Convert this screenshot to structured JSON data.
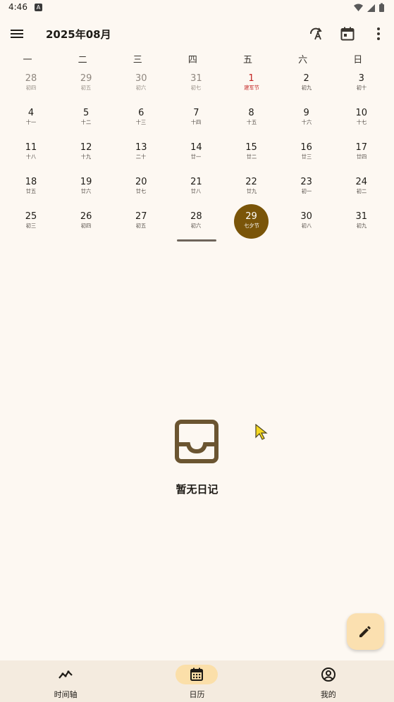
{
  "status_bar": {
    "time": "4:46",
    "notification_glyph": "A"
  },
  "app_bar": {
    "title": "2025年08月"
  },
  "weekdays": [
    "一",
    "二",
    "三",
    "四",
    "五",
    "六",
    "日"
  ],
  "calendar": {
    "weeks": [
      [
        {
          "day": "28",
          "lunar": "初四",
          "state": "other"
        },
        {
          "day": "29",
          "lunar": "初五",
          "state": "other"
        },
        {
          "day": "30",
          "lunar": "初六",
          "state": "other"
        },
        {
          "day": "31",
          "lunar": "初七",
          "state": "other"
        },
        {
          "day": "1",
          "lunar": "建军节",
          "state": "holiday"
        },
        {
          "day": "2",
          "lunar": "初九",
          "state": "normal"
        },
        {
          "day": "3",
          "lunar": "初十",
          "state": "normal"
        }
      ],
      [
        {
          "day": "4",
          "lunar": "十一",
          "state": "normal"
        },
        {
          "day": "5",
          "lunar": "十二",
          "state": "normal"
        },
        {
          "day": "6",
          "lunar": "十三",
          "state": "normal"
        },
        {
          "day": "7",
          "lunar": "十四",
          "state": "normal"
        },
        {
          "day": "8",
          "lunar": "十五",
          "state": "normal"
        },
        {
          "day": "9",
          "lunar": "十六",
          "state": "normal"
        },
        {
          "day": "10",
          "lunar": "十七",
          "state": "normal"
        }
      ],
      [
        {
          "day": "11",
          "lunar": "十八",
          "state": "normal"
        },
        {
          "day": "12",
          "lunar": "十九",
          "state": "normal"
        },
        {
          "day": "13",
          "lunar": "二十",
          "state": "normal"
        },
        {
          "day": "14",
          "lunar": "廿一",
          "state": "normal"
        },
        {
          "day": "15",
          "lunar": "廿二",
          "state": "normal"
        },
        {
          "day": "16",
          "lunar": "廿三",
          "state": "normal"
        },
        {
          "day": "17",
          "lunar": "廿四",
          "state": "normal"
        }
      ],
      [
        {
          "day": "18",
          "lunar": "廿五",
          "state": "normal"
        },
        {
          "day": "19",
          "lunar": "廿六",
          "state": "normal"
        },
        {
          "day": "20",
          "lunar": "廿七",
          "state": "normal"
        },
        {
          "day": "21",
          "lunar": "廿八",
          "state": "normal"
        },
        {
          "day": "22",
          "lunar": "廿九",
          "state": "normal"
        },
        {
          "day": "23",
          "lunar": "初一",
          "state": "normal"
        },
        {
          "day": "24",
          "lunar": "初二",
          "state": "normal"
        }
      ],
      [
        {
          "day": "25",
          "lunar": "初三",
          "state": "normal"
        },
        {
          "day": "26",
          "lunar": "初四",
          "state": "normal"
        },
        {
          "day": "27",
          "lunar": "初五",
          "state": "normal"
        },
        {
          "day": "28",
          "lunar": "初六",
          "state": "normal"
        },
        {
          "day": "29",
          "lunar": "七夕节",
          "state": "selected"
        },
        {
          "day": "30",
          "lunar": "初八",
          "state": "normal"
        },
        {
          "day": "31",
          "lunar": "初九",
          "state": "normal"
        }
      ]
    ]
  },
  "empty_state": {
    "message": "暂无日记"
  },
  "bottom_nav": {
    "items": [
      {
        "label": "时间轴",
        "icon": "timeline-icon",
        "active": false
      },
      {
        "label": "日历",
        "icon": "calendar-icon",
        "active": true
      },
      {
        "label": "我的",
        "icon": "account-icon",
        "active": false
      }
    ]
  },
  "colors": {
    "background": "#fdf8f2",
    "accent": "#7a5509",
    "holiday": "#c21f1f",
    "fab": "#fbe0b0",
    "nav_background": "#f4ebdf",
    "nav_indicator": "#fbdfa9"
  }
}
